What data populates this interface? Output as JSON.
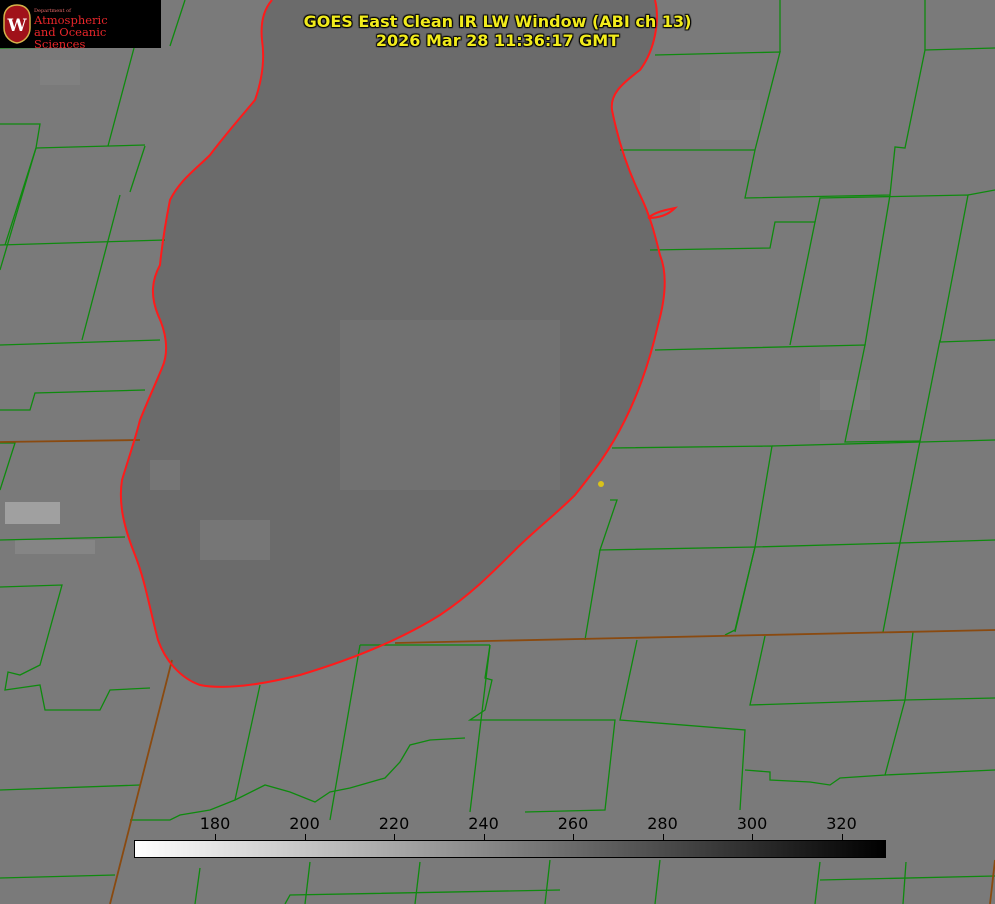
{
  "title": {
    "line1": "GOES East Clean IR LW Window (ABI ch 13)",
    "line2": "2026 Mar 28 11:36:17 GMT"
  },
  "logo": {
    "department": "Department of",
    "line1": "Atmospheric",
    "line2": "and Oceanic Sciences",
    "seal_letter": "W"
  },
  "colorbar": {
    "ticks": [
      "180",
      "200",
      "220",
      "240",
      "260",
      "280",
      "300",
      "320"
    ],
    "gradient_from": "#ffffff",
    "gradient_to": "#000000"
  },
  "colors": {
    "land": "#7a7a7a",
    "lake": "#6a6a6a",
    "county_lines": "#0e8a0e",
    "state_lines": "#8a4a10",
    "coastline": "#ff1a1a",
    "title_text": "#f2ec1c",
    "marker": "#d9c21a"
  }
}
